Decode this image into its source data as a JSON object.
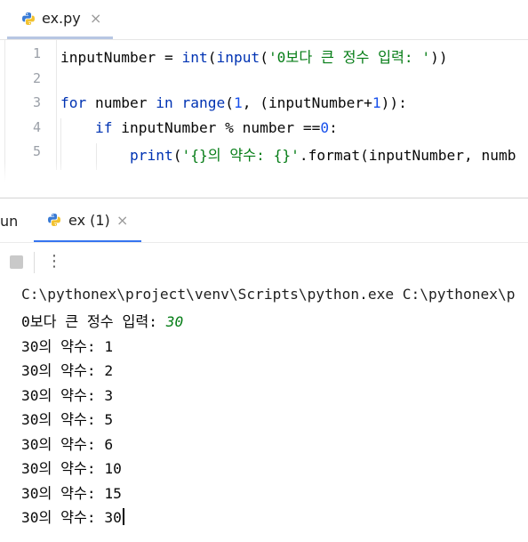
{
  "editor": {
    "tab": {
      "label": "ex.py",
      "close": "×",
      "icon": "python-icon"
    },
    "lines": [
      {
        "num": "1",
        "parts": [
          [
            "inputNumber = ",
            ""
          ],
          [
            "int",
            "kw"
          ],
          [
            "(",
            ""
          ],
          [
            "input",
            "kw"
          ],
          [
            "(",
            ""
          ],
          [
            "'0보다 큰 정수 입력: '",
            "str"
          ],
          [
            "))",
            ""
          ]
        ]
      },
      {
        "num": "2",
        "parts": []
      },
      {
        "num": "3",
        "parts": [
          [
            "for",
            "kw"
          ],
          [
            " number ",
            ""
          ],
          [
            "in",
            "kw"
          ],
          [
            " ",
            ""
          ],
          [
            "range",
            "kw"
          ],
          [
            "(",
            ""
          ],
          [
            "1",
            "num"
          ],
          [
            ", (inputNumber+",
            ""
          ],
          [
            "1",
            "num"
          ],
          [
            "))",
            ""
          ],
          [
            ":",
            ""
          ]
        ]
      },
      {
        "num": "4",
        "parts": [
          [
            "    ",
            ""
          ],
          [
            "if",
            "kw"
          ],
          [
            " inputNumber % number ==",
            ""
          ],
          [
            "0",
            "num"
          ],
          [
            ":",
            ""
          ]
        ]
      },
      {
        "num": "5",
        "parts": [
          [
            "        ",
            ""
          ],
          [
            "print",
            "kw"
          ],
          [
            "(",
            ""
          ],
          [
            "'{}의 약수: {}'",
            "str"
          ],
          [
            ".format(inputNumber, numb",
            ""
          ]
        ]
      }
    ]
  },
  "run_panel": {
    "title": "un",
    "tab": {
      "label": "ex (1)",
      "close": "×",
      "icon": "python-icon"
    },
    "toolbar": {
      "stop_icon": "stop-icon",
      "more": "⋮"
    }
  },
  "console": {
    "command": "C:\\pythonex\\project\\venv\\Scripts\\python.exe C:\\pythonex\\p",
    "prompt": "0보다 큰 정수 입력: ",
    "user_input": "30",
    "outputs": [
      "30의 약수: 1",
      "30의 약수: 2",
      "30의 약수: 3",
      "30의 약수: 5",
      "30의 약수: 6",
      "30의 약수: 10",
      "30의 약수: 15",
      "30의 약수: 30"
    ]
  },
  "colors": {
    "keyword": "#0033b3",
    "string": "#067d17",
    "number": "#1750eb",
    "active_tab_underline": "#3574f0"
  }
}
